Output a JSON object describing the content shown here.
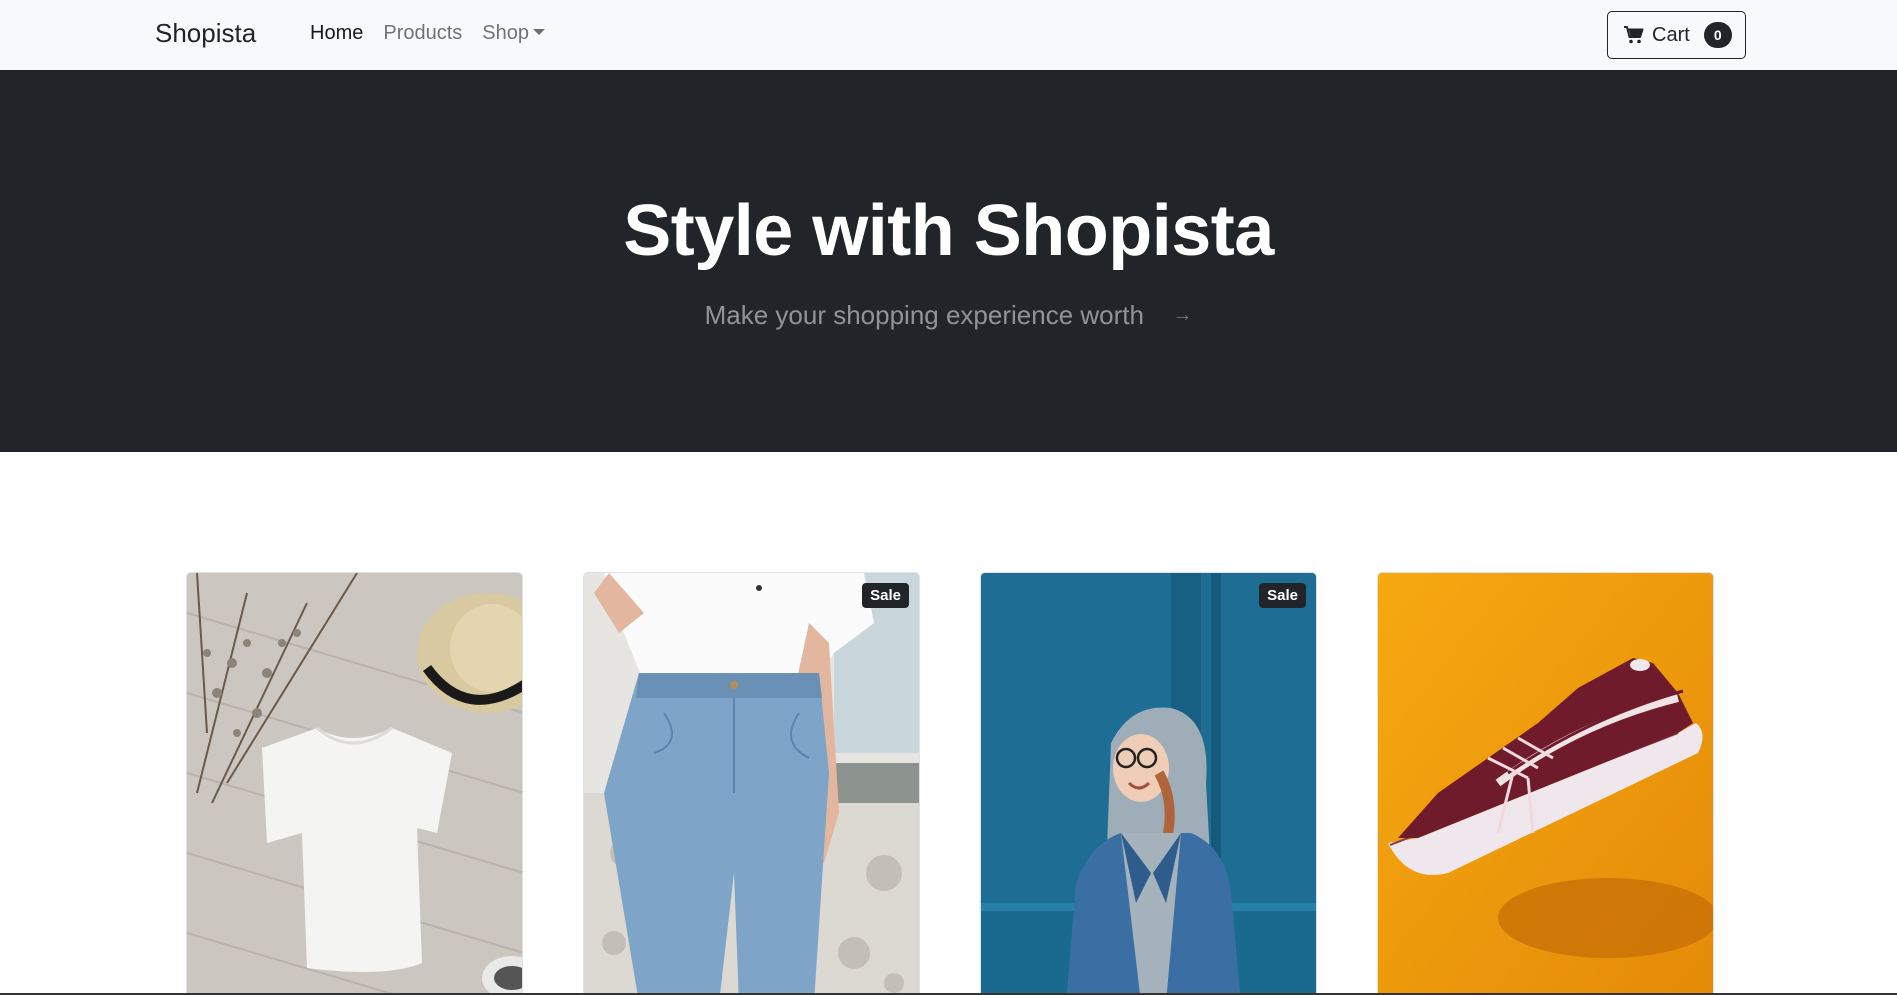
{
  "navbar": {
    "brand": "Shopista",
    "links": [
      {
        "label": "Home",
        "active": true
      },
      {
        "label": "Products",
        "active": false
      },
      {
        "label": "Shop",
        "active": false,
        "dropdown": true
      }
    ],
    "cart": {
      "label": "Cart",
      "count": "0",
      "icon": "cart-icon"
    }
  },
  "hero": {
    "title": "Style with Shopista",
    "subtitle": "Make your shopping experience worth",
    "icon": "arrow-right-icon"
  },
  "products": [
    {
      "image": "white t-shirt with hat flatlay",
      "sale": false
    },
    {
      "image": "woman in blue jeans",
      "sale": true,
      "badge": "Sale"
    },
    {
      "image": "smiling woman in denim jacket",
      "sale": true,
      "badge": "Sale"
    },
    {
      "image": "maroon sneaker on orange",
      "sale": false
    }
  ],
  "colors": {
    "navbar_bg": "#f8f9fa",
    "hero_bg": "#212529",
    "badge_bg": "#212529"
  }
}
